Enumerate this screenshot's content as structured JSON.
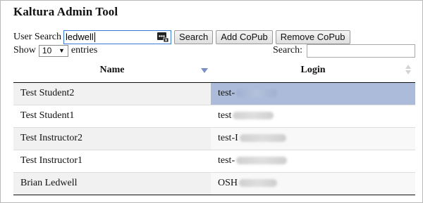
{
  "app": {
    "title": "Kaltura Admin Tool"
  },
  "user_search": {
    "label": "User Search",
    "value": "ledwell",
    "icon": "password-manager-icon",
    "buttons": {
      "search": "Search",
      "add": "Add CoPub",
      "remove": "Remove CoPub"
    }
  },
  "length_control": {
    "prefix": "Show",
    "selected": "10",
    "suffix": "entries"
  },
  "filter": {
    "label": "Search:",
    "value": ""
  },
  "table": {
    "headers": {
      "name": "Name",
      "login": "Login"
    },
    "sort": {
      "column": "name",
      "direction": "descending"
    },
    "rows": [
      {
        "name": "Test Student2",
        "login_visible": "test-",
        "selected": true
      },
      {
        "name": "Test Student1",
        "login_visible": "test",
        "selected": false
      },
      {
        "name": "Test Instructor2",
        "login_visible": "test-I",
        "selected": false
      },
      {
        "name": "Test Instructor1",
        "login_visible": "test-",
        "selected": false
      },
      {
        "name": "Brian Ledwell",
        "login_visible": "OSH",
        "selected": false
      }
    ]
  },
  "colors": {
    "selected_row": "#acbbd9",
    "sort_arrow": "#7b8fc7",
    "input_focus": "#3a7bd5"
  }
}
